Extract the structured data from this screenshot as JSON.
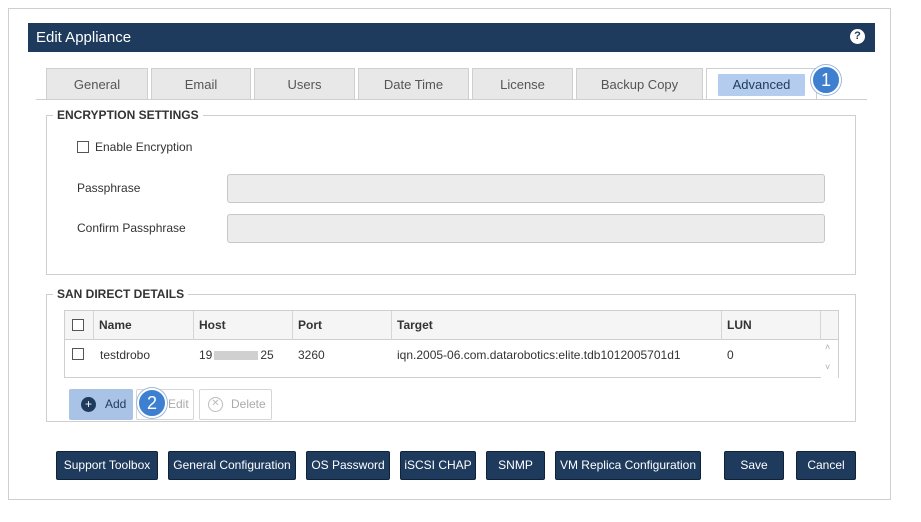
{
  "dialog": {
    "title": "Edit Appliance",
    "help_icon": "question-mark-icon"
  },
  "tabs": [
    {
      "label": "General"
    },
    {
      "label": "Email"
    },
    {
      "label": "Users"
    },
    {
      "label": "Date Time"
    },
    {
      "label": "License"
    },
    {
      "label": "Backup Copy"
    },
    {
      "label": "Advanced",
      "active": true
    }
  ],
  "callouts": [
    "1",
    "2"
  ],
  "encryption": {
    "legend": "ENCRYPTION SETTINGS",
    "enable_label": "Enable Encryption",
    "enabled": false,
    "passphrase_label": "Passphrase",
    "passphrase_value": "",
    "confirm_label": "Confirm Passphrase",
    "confirm_value": ""
  },
  "san": {
    "legend": "SAN DIRECT DETAILS",
    "columns": [
      "Name",
      "Host",
      "Port",
      "Target",
      "LUN"
    ],
    "rows": [
      {
        "name": "testdrobo",
        "host_start": "19",
        "host_end": "25",
        "port": "3260",
        "target": "iqn.2005-06.com.datarobotics:elite.tdb1012005701d1",
        "lun": "0"
      }
    ],
    "add_label": "Add",
    "edit_label": "Edit",
    "delete_label": "Delete"
  },
  "footer": {
    "support_toolbox": "Support Toolbox",
    "general_configuration": "General Configuration",
    "os_password": "OS Password",
    "iscsi_chap": "iSCSI CHAP",
    "snmp": "SNMP",
    "vm_replica": "VM Replica Configuration",
    "save": "Save",
    "cancel": "Cancel"
  },
  "colors": {
    "titlebar": "#1e3a5c",
    "accent": "#3f7fd0",
    "active_tab": "#b4cdee"
  }
}
